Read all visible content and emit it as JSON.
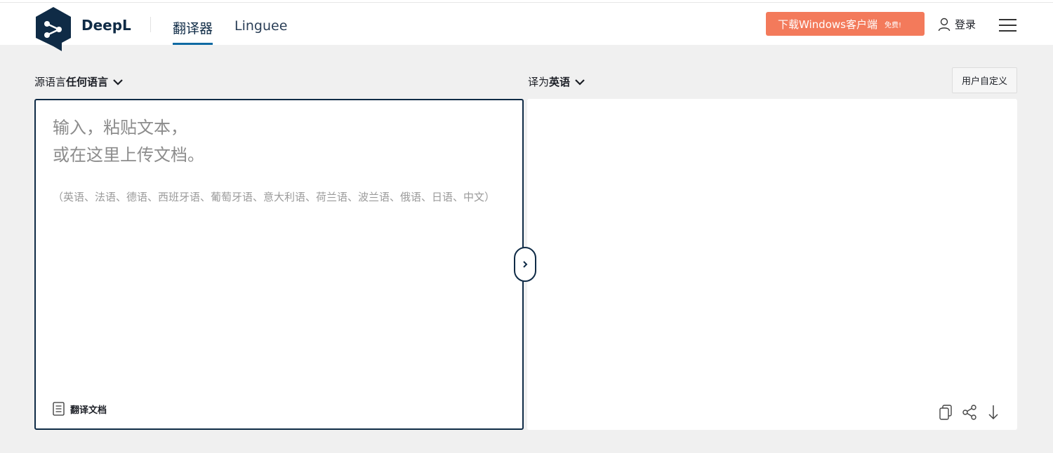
{
  "header": {
    "brand": "DeepL",
    "tabs": [
      {
        "label": "翻译器",
        "active": true
      },
      {
        "label": "Linguee",
        "active": false
      }
    ],
    "download_label": "下载Windows客户端",
    "download_badge": "免费!",
    "login_label": "登录",
    "accent_color": "#0f6aa3",
    "download_color": "#f37a5b"
  },
  "source": {
    "lang_prefix": "源语言",
    "lang_value": "任何语言",
    "placeholder_line1": "输入，粘贴文本，",
    "placeholder_line2": "或在这里上传文档。",
    "hint": "（英语、法语、德语、西班牙语、葡萄牙语、意大利语、荷兰语、波兰语、俄语、日语、中文）",
    "doc_button": "翻译文档"
  },
  "target": {
    "lang_prefix": "译为",
    "lang_value": "英语",
    "glossary_button": "用户自定义"
  },
  "icons": [
    "deepl-logo-icon",
    "user-icon",
    "hamburger-menu-icon",
    "chevron-down-icon",
    "document-icon",
    "chevron-right-icon",
    "copy-icon",
    "share-icon",
    "download-icon"
  ]
}
